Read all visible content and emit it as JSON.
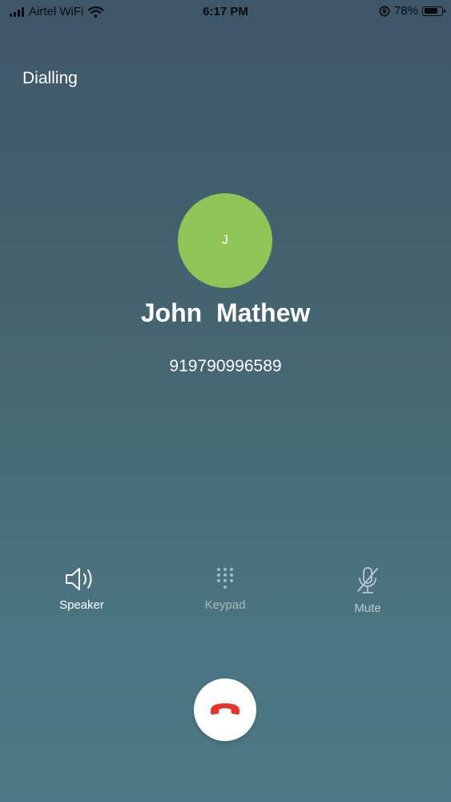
{
  "status_bar": {
    "carrier": "Airtel WiFi",
    "time": "6:17 PM",
    "battery_percent": "78%",
    "battery_level": 0.78,
    "icons": [
      "signal-icon",
      "wifi-icon",
      "orientation-lock-icon",
      "battery-icon"
    ]
  },
  "call": {
    "state": "Dialling",
    "avatar_initial": "J",
    "avatar_color": "#8fc556",
    "contact_name": "John  Mathew",
    "contact_number": "919790996589"
  },
  "controls": {
    "speaker_label": "Speaker",
    "keypad_label": "Keypad",
    "mute_label": "Mute",
    "icons": [
      "speaker-icon",
      "keypad-icon",
      "mute-icon"
    ]
  },
  "end_call": {
    "icon": "end-call-icon",
    "color": "#e8332a"
  }
}
